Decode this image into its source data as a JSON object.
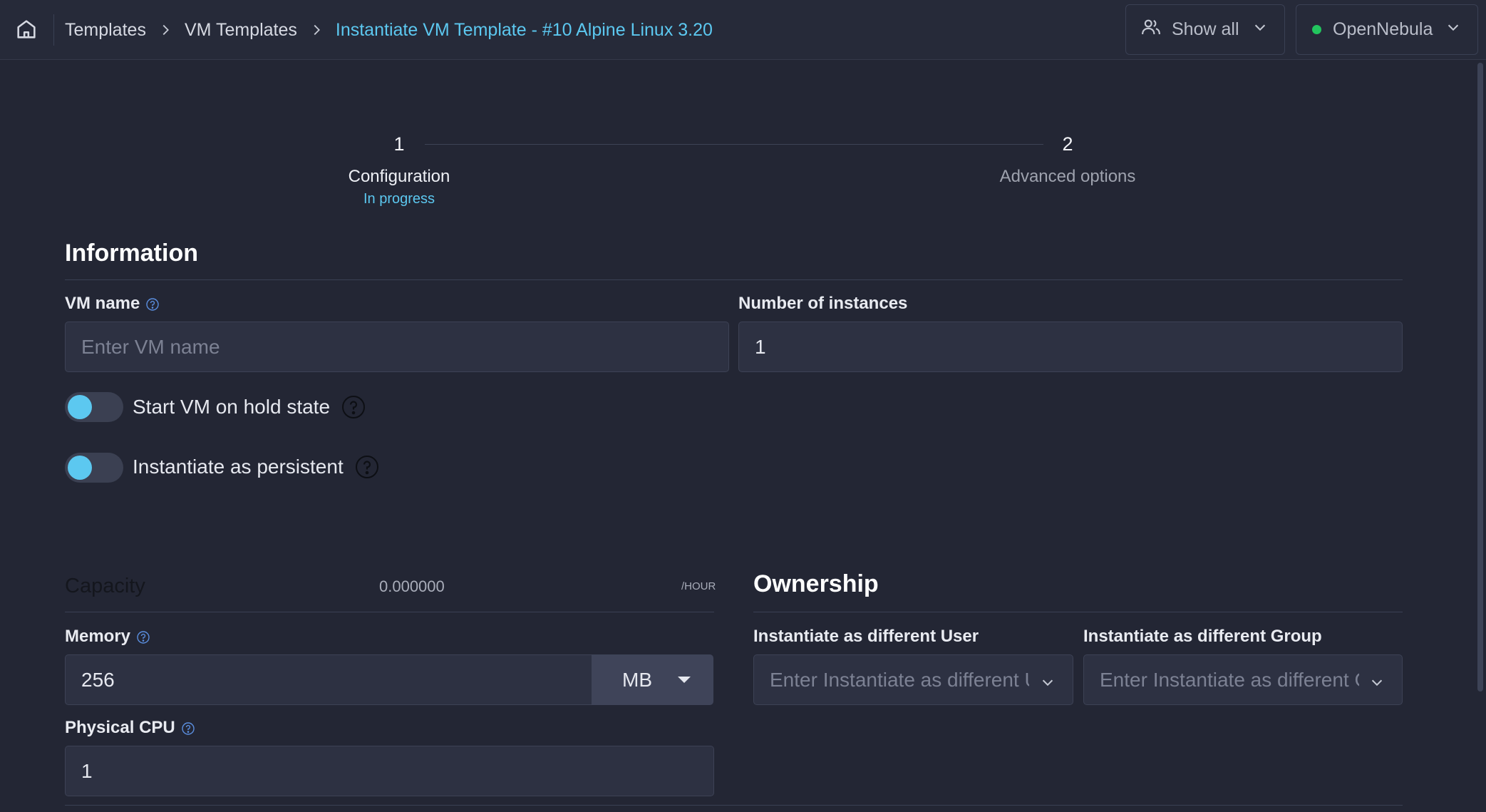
{
  "breadcrumb": {
    "items": [
      "Templates",
      "VM Templates"
    ],
    "current": "Instantiate VM Template - #10 Alpine Linux 3.20"
  },
  "header": {
    "filter_label": "Show all",
    "zone_label": "OpenNebula",
    "zone_status_color": "#22c55e"
  },
  "stepper": {
    "steps": [
      {
        "number": "1",
        "label": "Configuration",
        "status": "In progress"
      },
      {
        "number": "2",
        "label": "Advanced options"
      }
    ]
  },
  "information": {
    "title": "Information",
    "vm_name": {
      "label": "VM name",
      "placeholder": "Enter VM name",
      "value": ""
    },
    "instances": {
      "label": "Number of instances",
      "value": "1"
    },
    "hold_toggle": {
      "label": "Start VM on hold state"
    },
    "persistent_toggle": {
      "label": "Instantiate as persistent"
    }
  },
  "capacity": {
    "title": "Capacity",
    "price": "0.000000",
    "price_unit": "/HOUR",
    "memory": {
      "label": "Memory",
      "value": "256",
      "unit": "MB"
    },
    "cpu": {
      "label": "Physical CPU",
      "value": "1"
    }
  },
  "ownership": {
    "title": "Ownership",
    "user": {
      "label": "Instantiate as different User",
      "placeholder": "Enter Instantiate as different User"
    },
    "group": {
      "label": "Instantiate as different Group",
      "placeholder": "Enter Instantiate as different Group"
    }
  },
  "colors": {
    "accent": "#5cc8f0",
    "background": "#232634"
  }
}
